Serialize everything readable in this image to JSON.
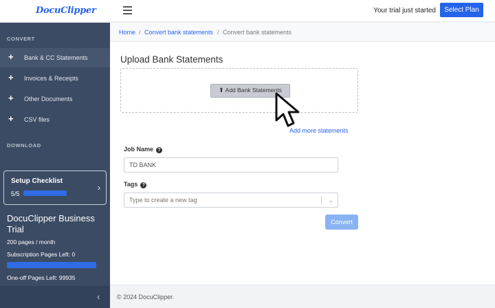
{
  "header": {
    "logo": "DocuClipper",
    "trial_text": "Your trial just started",
    "select_plan_label": "Select Plan"
  },
  "sidebar": {
    "convert_heading": "CONVERT",
    "items": [
      {
        "label": "Bank & CC Statements",
        "icon": "plus-icon",
        "active": true
      },
      {
        "label": "Invoices & Receipts",
        "icon": "plus-icon",
        "active": false
      },
      {
        "label": "Other Documents",
        "icon": "plus-icon",
        "active": false
      },
      {
        "label": "CSV files",
        "icon": "plus-icon",
        "active": false
      }
    ],
    "download_heading": "DOWNLOAD",
    "checklist": {
      "title": "Setup Checklist",
      "progress": "5/5",
      "progress_fraction": 1.0
    },
    "plan": {
      "title": "DocuClipper Business Trial",
      "pages_per_month": "200 pages / month",
      "subscription_left": "Subscription Pages Left: 0",
      "oneoff_left": "One-off Pages Left: 99935"
    }
  },
  "breadcrumb": {
    "home": "Home",
    "sep": "/",
    "level1": "Convert bank statements",
    "current": "Convert bank statements"
  },
  "main": {
    "title": "Upload Bank Statements",
    "add_button_label": "Add Bank Statements",
    "add_more_label": "Add more statements",
    "job_name_label": "Job Name",
    "job_name_value": "TD BANK",
    "tags_label": "Tags",
    "tags_placeholder": "Type to create a new tag",
    "convert_label": "Convert"
  },
  "footer": {
    "text": "© 2024 DocuClipper."
  },
  "colors": {
    "accent": "#2563eb",
    "sidebar": "#3b4b63",
    "convert_disabled": "#8ab3f2"
  }
}
